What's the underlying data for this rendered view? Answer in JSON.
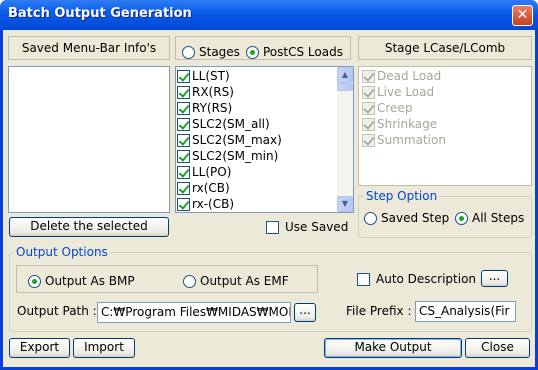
{
  "window": {
    "title": "Batch Output Generation",
    "close_glyph": "✕"
  },
  "saved_menu": {
    "header": "Saved Menu-Bar Info's",
    "items": [],
    "delete_label": "Delete the selected"
  },
  "mode": {
    "stages_label": "Stages",
    "postcs_label": "PostCS Loads",
    "selected": "PostCS Loads"
  },
  "loads": {
    "items": [
      {
        "label": "LL(ST)",
        "checked": true
      },
      {
        "label": "RX(RS)",
        "checked": true
      },
      {
        "label": "RY(RS)",
        "checked": true
      },
      {
        "label": "SLC2(SM_all)",
        "checked": true
      },
      {
        "label": "SLC2(SM_max)",
        "checked": true
      },
      {
        "label": "SLC2(SM_min)",
        "checked": true
      },
      {
        "label": "LL(PO)",
        "checked": true
      },
      {
        "label": "rx(CB)",
        "checked": true
      },
      {
        "label": "rx-(CB)",
        "checked": true
      }
    ],
    "use_saved_label": "Use Saved",
    "use_saved_checked": false
  },
  "stage_lcase": {
    "header": "Stage LCase/LComb",
    "items": [
      {
        "label": "Dead Load",
        "checked": true
      },
      {
        "label": "Live Load",
        "checked": true
      },
      {
        "label": "Creep",
        "checked": true
      },
      {
        "label": "Shrinkage",
        "checked": true
      },
      {
        "label": "Summation",
        "checked": true
      }
    ]
  },
  "step_option": {
    "title": "Step Option",
    "saved_step_label": "Saved Step",
    "all_steps_label": "All Steps",
    "selected": "All Steps"
  },
  "output_options": {
    "title": "Output Options",
    "bmp_label": "Output As BMP",
    "emf_label": "Output As EMF",
    "selected": "BMP",
    "auto_description_label": "Auto Description",
    "auto_description_checked": false,
    "ellipsis": "...",
    "output_path_label": "Output Path :",
    "output_path_value": "C:₩Program Files₩MIDAS₩MOD",
    "file_prefix_label": "File Prefix :",
    "file_prefix_value": "CS_Analysis(Fir"
  },
  "buttons": {
    "export": "Export",
    "import": "Import",
    "make_output": "Make Output",
    "close": "Close"
  },
  "icons": {
    "scroll_up": "▲",
    "scroll_down": "▼"
  },
  "colors": {
    "title_bar": "#0a5fe8",
    "group_label": "#0046d5",
    "check_mark": "#21a121"
  }
}
